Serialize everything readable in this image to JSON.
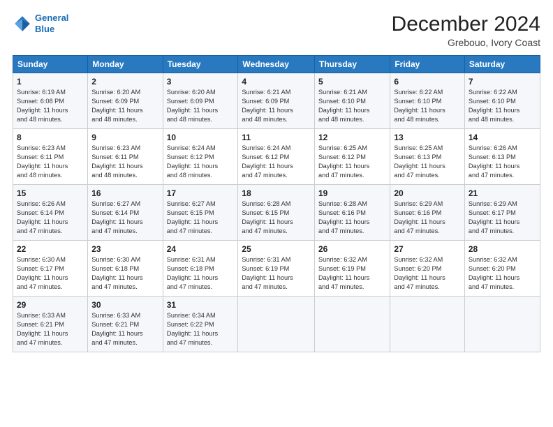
{
  "header": {
    "logo_line1": "General",
    "logo_line2": "Blue",
    "main_title": "December 2024",
    "subtitle": "Grebouo, Ivory Coast"
  },
  "calendar": {
    "days_of_week": [
      "Sunday",
      "Monday",
      "Tuesday",
      "Wednesday",
      "Thursday",
      "Friday",
      "Saturday"
    ],
    "weeks": [
      [
        {
          "day": "1",
          "info": "Sunrise: 6:19 AM\nSunset: 6:08 PM\nDaylight: 11 hours\nand 48 minutes."
        },
        {
          "day": "2",
          "info": "Sunrise: 6:20 AM\nSunset: 6:09 PM\nDaylight: 11 hours\nand 48 minutes."
        },
        {
          "day": "3",
          "info": "Sunrise: 6:20 AM\nSunset: 6:09 PM\nDaylight: 11 hours\nand 48 minutes."
        },
        {
          "day": "4",
          "info": "Sunrise: 6:21 AM\nSunset: 6:09 PM\nDaylight: 11 hours\nand 48 minutes."
        },
        {
          "day": "5",
          "info": "Sunrise: 6:21 AM\nSunset: 6:10 PM\nDaylight: 11 hours\nand 48 minutes."
        },
        {
          "day": "6",
          "info": "Sunrise: 6:22 AM\nSunset: 6:10 PM\nDaylight: 11 hours\nand 48 minutes."
        },
        {
          "day": "7",
          "info": "Sunrise: 6:22 AM\nSunset: 6:10 PM\nDaylight: 11 hours\nand 48 minutes."
        }
      ],
      [
        {
          "day": "8",
          "info": "Sunrise: 6:23 AM\nSunset: 6:11 PM\nDaylight: 11 hours\nand 48 minutes."
        },
        {
          "day": "9",
          "info": "Sunrise: 6:23 AM\nSunset: 6:11 PM\nDaylight: 11 hours\nand 48 minutes."
        },
        {
          "day": "10",
          "info": "Sunrise: 6:24 AM\nSunset: 6:12 PM\nDaylight: 11 hours\nand 48 minutes."
        },
        {
          "day": "11",
          "info": "Sunrise: 6:24 AM\nSunset: 6:12 PM\nDaylight: 11 hours\nand 47 minutes."
        },
        {
          "day": "12",
          "info": "Sunrise: 6:25 AM\nSunset: 6:12 PM\nDaylight: 11 hours\nand 47 minutes."
        },
        {
          "day": "13",
          "info": "Sunrise: 6:25 AM\nSunset: 6:13 PM\nDaylight: 11 hours\nand 47 minutes."
        },
        {
          "day": "14",
          "info": "Sunrise: 6:26 AM\nSunset: 6:13 PM\nDaylight: 11 hours\nand 47 minutes."
        }
      ],
      [
        {
          "day": "15",
          "info": "Sunrise: 6:26 AM\nSunset: 6:14 PM\nDaylight: 11 hours\nand 47 minutes."
        },
        {
          "day": "16",
          "info": "Sunrise: 6:27 AM\nSunset: 6:14 PM\nDaylight: 11 hours\nand 47 minutes."
        },
        {
          "day": "17",
          "info": "Sunrise: 6:27 AM\nSunset: 6:15 PM\nDaylight: 11 hours\nand 47 minutes."
        },
        {
          "day": "18",
          "info": "Sunrise: 6:28 AM\nSunset: 6:15 PM\nDaylight: 11 hours\nand 47 minutes."
        },
        {
          "day": "19",
          "info": "Sunrise: 6:28 AM\nSunset: 6:16 PM\nDaylight: 11 hours\nand 47 minutes."
        },
        {
          "day": "20",
          "info": "Sunrise: 6:29 AM\nSunset: 6:16 PM\nDaylight: 11 hours\nand 47 minutes."
        },
        {
          "day": "21",
          "info": "Sunrise: 6:29 AM\nSunset: 6:17 PM\nDaylight: 11 hours\nand 47 minutes."
        }
      ],
      [
        {
          "day": "22",
          "info": "Sunrise: 6:30 AM\nSunset: 6:17 PM\nDaylight: 11 hours\nand 47 minutes."
        },
        {
          "day": "23",
          "info": "Sunrise: 6:30 AM\nSunset: 6:18 PM\nDaylight: 11 hours\nand 47 minutes."
        },
        {
          "day": "24",
          "info": "Sunrise: 6:31 AM\nSunset: 6:18 PM\nDaylight: 11 hours\nand 47 minutes."
        },
        {
          "day": "25",
          "info": "Sunrise: 6:31 AM\nSunset: 6:19 PM\nDaylight: 11 hours\nand 47 minutes."
        },
        {
          "day": "26",
          "info": "Sunrise: 6:32 AM\nSunset: 6:19 PM\nDaylight: 11 hours\nand 47 minutes."
        },
        {
          "day": "27",
          "info": "Sunrise: 6:32 AM\nSunset: 6:20 PM\nDaylight: 11 hours\nand 47 minutes."
        },
        {
          "day": "28",
          "info": "Sunrise: 6:32 AM\nSunset: 6:20 PM\nDaylight: 11 hours\nand 47 minutes."
        }
      ],
      [
        {
          "day": "29",
          "info": "Sunrise: 6:33 AM\nSunset: 6:21 PM\nDaylight: 11 hours\nand 47 minutes."
        },
        {
          "day": "30",
          "info": "Sunrise: 6:33 AM\nSunset: 6:21 PM\nDaylight: 11 hours\nand 47 minutes."
        },
        {
          "day": "31",
          "info": "Sunrise: 6:34 AM\nSunset: 6:22 PM\nDaylight: 11 hours\nand 47 minutes."
        },
        {
          "day": "",
          "info": ""
        },
        {
          "day": "",
          "info": ""
        },
        {
          "day": "",
          "info": ""
        },
        {
          "day": "",
          "info": ""
        }
      ]
    ]
  }
}
